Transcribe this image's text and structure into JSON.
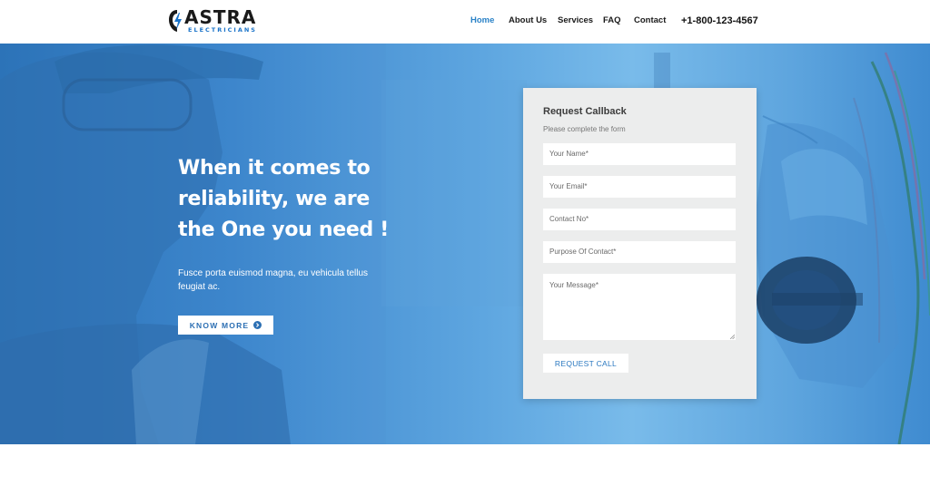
{
  "header": {
    "logo": {
      "name": "ASTRA",
      "tagline": "ELECTRICIANS"
    },
    "nav": [
      {
        "label": "Home",
        "active": true
      },
      {
        "label": "About Us",
        "active": false
      },
      {
        "label": "Services",
        "active": false
      },
      {
        "label": "FAQ",
        "active": false
      },
      {
        "label": "Contact",
        "active": false
      }
    ],
    "phone": "+1-800-123-4567"
  },
  "hero": {
    "headline": [
      "When it comes to",
      "reliability, we are",
      "the One you need !"
    ],
    "subtext": "Fusce porta euismod magna, eu vehicula tellus feugiat ac.",
    "cta_label": "KNOW MORE",
    "cta_icon": "arrow-circle-right-icon"
  },
  "form": {
    "title": "Request Callback",
    "subtitle": "Please complete the form",
    "name_placeholder": "Your Name*",
    "email_placeholder": "Your Email*",
    "contact_placeholder": "Contact No*",
    "purpose_placeholder": "Purpose Of Contact*",
    "message_placeholder": "Your Message*",
    "submit_label": "REQUEST CALL"
  },
  "colors": {
    "accent": "#2a82c7",
    "hero_overlay": "#3d86cc",
    "form_bg": "#eceded"
  }
}
